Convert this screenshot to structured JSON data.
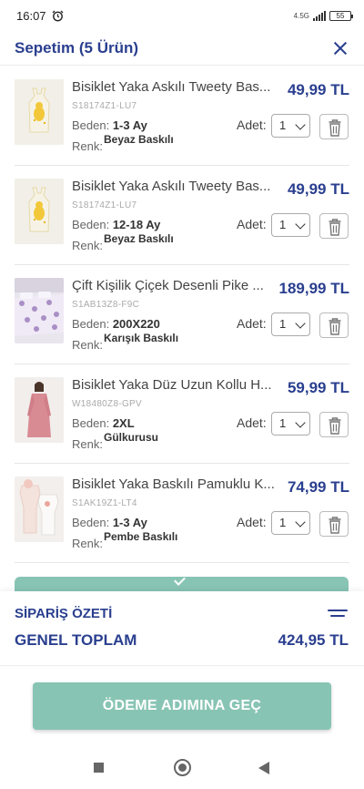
{
  "status_bar": {
    "time": "16:07",
    "network": "4.5G",
    "battery": "55"
  },
  "header": {
    "title": "Sepetim (5 Ürün)"
  },
  "labels": {
    "size": "Beden:",
    "color": "Renk:",
    "quantity": "Adet:"
  },
  "items": [
    {
      "name": "Bisiklet Yaka Askılı Tweety Bas...",
      "price": "49,99 TL",
      "sku": "S18174Z1-LU7",
      "size": "1-3 Ay",
      "color": "Beyaz Baskılı",
      "qty": "1"
    },
    {
      "name": "Bisiklet Yaka Askılı Tweety Bas...",
      "price": "49,99 TL",
      "sku": "S18174Z1-LU7",
      "size": "12-18 Ay",
      "color": "Beyaz Baskılı",
      "qty": "1"
    },
    {
      "name": "Çift Kişilik Çiçek Desenli Pike ...",
      "price": "189,99 TL",
      "sku": "S1AB13Z8-F9C",
      "size": "200X220",
      "color": "Karışık Baskılı",
      "qty": "1"
    },
    {
      "name": "Bisiklet Yaka Düz Uzun Kollu H...",
      "price": "59,99 TL",
      "sku": "W18480Z8-GPV",
      "size": "2XL",
      "color": "Gülkurusu",
      "qty": "1"
    },
    {
      "name": "Bisiklet Yaka Baskılı Pamuklu K...",
      "price": "74,99 TL",
      "sku": "S1AK19Z1-LT4",
      "size": "1-3 Ay",
      "color": "Pembe Baskılı",
      "qty": "1"
    }
  ],
  "summary": {
    "title": "SİPARİŞ ÖZETİ",
    "total_label": "GENEL TOPLAM",
    "total_value": "424,95 TL"
  },
  "checkout": {
    "label": "ÖDEME ADIMINA GEÇ"
  },
  "colors": {
    "brand": "#2a3f8f",
    "accent": "#88c4b4"
  },
  "icons": {
    "close": "close-icon",
    "delete": "trash-icon",
    "dropdown": "chevron-down-icon",
    "summary": "menu-icon",
    "check": "check-icon"
  }
}
